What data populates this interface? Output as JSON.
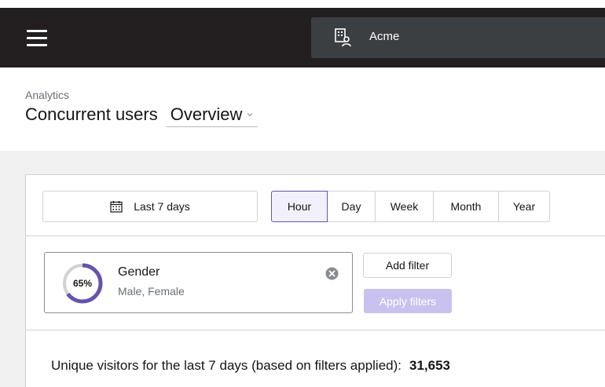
{
  "topbar": {
    "menu_icon": "hamburger-menu-icon",
    "org_icon": "organization-icon",
    "org_name": "Acme"
  },
  "header": {
    "breadcrumb": "Analytics",
    "title": "Concurrent users",
    "view_select": {
      "value": "Overview",
      "icon": "chevron-down-icon"
    }
  },
  "toolbar": {
    "date_range": {
      "icon": "calendar-icon",
      "label": "Last 7 days"
    },
    "granularity": {
      "options": [
        "Hour",
        "Day",
        "Week",
        "Month",
        "Year"
      ],
      "selected": "Hour"
    }
  },
  "filters": {
    "chip": {
      "percent": 65,
      "percent_label": "65%",
      "title": "Gender",
      "subtitle": "Male, Female",
      "close_icon": "close-circle-icon"
    },
    "add_label": "Add filter",
    "apply_label": "Apply filters"
  },
  "summary": {
    "label": "Unique visitors for the last 7 days (based on filters applied):",
    "count": "31,653"
  },
  "colors": {
    "topbar_bg": "#231f20",
    "org_switch_bg": "#3c3f42",
    "accent": "#6753ac",
    "accent_light": "#c9c2ef",
    "page_bg": "#f0f0f0"
  }
}
